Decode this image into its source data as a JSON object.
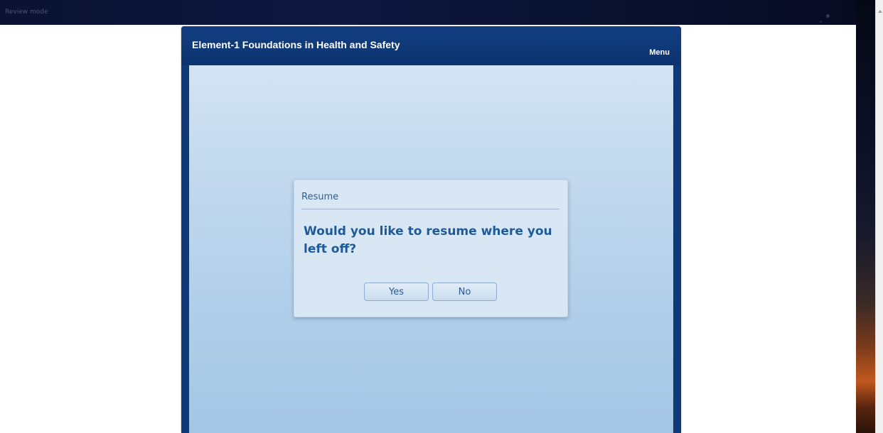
{
  "window": {
    "mode_label": "Review mode"
  },
  "player": {
    "course_title": "Element-1 Foundations in Health and Safety",
    "menu_label": "Menu"
  },
  "dialog": {
    "title": "Resume",
    "message": "Would you like to resume where you left off?",
    "buttons": {
      "yes_label": "Yes",
      "no_label": "No"
    }
  },
  "colors": {
    "header_blue": "#0e3a7a",
    "content_top": "#d3e3f2",
    "content_bottom": "#a3c6e5",
    "dialog_text": "#1d5a9a"
  },
  "icons": {
    "scroll_up": "scroll-up-arrow-icon"
  }
}
